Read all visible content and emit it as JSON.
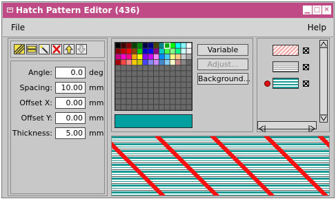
{
  "window": {
    "title": "Hatch Pattern Editor (436)",
    "minimize_glyph": "▁",
    "maximize_glyph": "□",
    "close_glyph": "✕"
  },
  "menu": {
    "file": "File",
    "help": "Help"
  },
  "toolbar": {
    "icons": [
      "hatch-icon",
      "layers-icon",
      "wand-icon",
      "delete-icon",
      "move-up-icon",
      "move-down-icon"
    ]
  },
  "fields": [
    {
      "label": "Angle:",
      "value": "0.0",
      "unit": "deg"
    },
    {
      "label": "Spacing:",
      "value": "10.00",
      "unit": "mm"
    },
    {
      "label": "Offset X:",
      "value": "0.00",
      "unit": "mm"
    },
    {
      "label": "Offset Y:",
      "value": "0.00",
      "unit": "mm"
    },
    {
      "label": "Thickness:",
      "value": "5.00",
      "unit": "mm"
    }
  ],
  "buttons": {
    "variable": "Variable",
    "adjust": "Adjust...",
    "background": "Background..."
  },
  "colors": {
    "title_bar": "#c04a86",
    "selected_color": "#00a0a0",
    "hatch_red": "#ff1010",
    "hatch_teal": "#1a9a94"
  },
  "layers": [
    {
      "style": "red-diagonal",
      "checked": true,
      "active": false
    },
    {
      "style": "gray-lines",
      "checked": true,
      "active": false
    },
    {
      "style": "teal-lines",
      "checked": true,
      "active": true
    }
  ]
}
